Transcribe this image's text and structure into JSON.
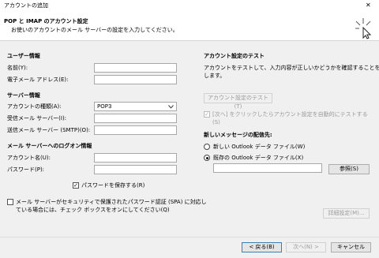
{
  "window": {
    "title": "アカウントの追加",
    "close_glyph": "✕"
  },
  "header": {
    "title": "POP と IMAP のアカウント設定",
    "subtitle": "お使いのアカウントのメール サーバーの設定を入力してください。"
  },
  "user_info": {
    "heading": "ユーザー情報",
    "name_label": "名前(Y):",
    "name_value": "",
    "email_label": "電子メール アドレス(E):",
    "email_value": ""
  },
  "server_info": {
    "heading": "サーバー情報",
    "account_type_label": "アカウントの種類(A):",
    "account_type_value": "POP3",
    "incoming_label": "受信メール サーバー(I):",
    "incoming_value": "",
    "outgoing_label": "送信メール サーバー (SMTP)(O):",
    "outgoing_value": ""
  },
  "logon_info": {
    "heading": "メール サーバーへのログオン情報",
    "account_name_label": "アカウント名(U):",
    "account_name_value": "",
    "password_label": "パスワード(P):",
    "password_value": "",
    "save_password_label": "パスワードを保存する(R)",
    "save_password_checked": true,
    "spa_label_line1": "メール サーバーがセキュリティで保護されたパスワード認証 (SPA) に対応し",
    "spa_label_line2": "ている場合には、チェック ボックスをオンにしてください(Q)",
    "spa_checked": false
  },
  "test_settings": {
    "heading": "アカウント設定のテスト",
    "description_line1": "アカウントをテストして、入力内容が正しいかどうかを確認することをお勧め",
    "description_line2": "します。",
    "test_button_label": "アカウント設定のテスト(T)",
    "auto_test_label_line1": "[次へ] をクリックしたらアカウント設定を自動的にテストする",
    "auto_test_label_line2": "(S)",
    "auto_test_checked": true
  },
  "delivery": {
    "heading": "新しいメッセージの配信先:",
    "new_pst_label": "新しい Outlook データ ファイル(W)",
    "existing_pst_label": "既存の Outlook データ ファイル(X)",
    "selected": "existing",
    "path_value": "",
    "browse_label": "参照(S)"
  },
  "more_settings_label": "詳細設定(M)...",
  "footer": {
    "back_label": "< 戻る(B)",
    "next_label": "次へ(N) >",
    "cancel_label": "キャンセル"
  }
}
